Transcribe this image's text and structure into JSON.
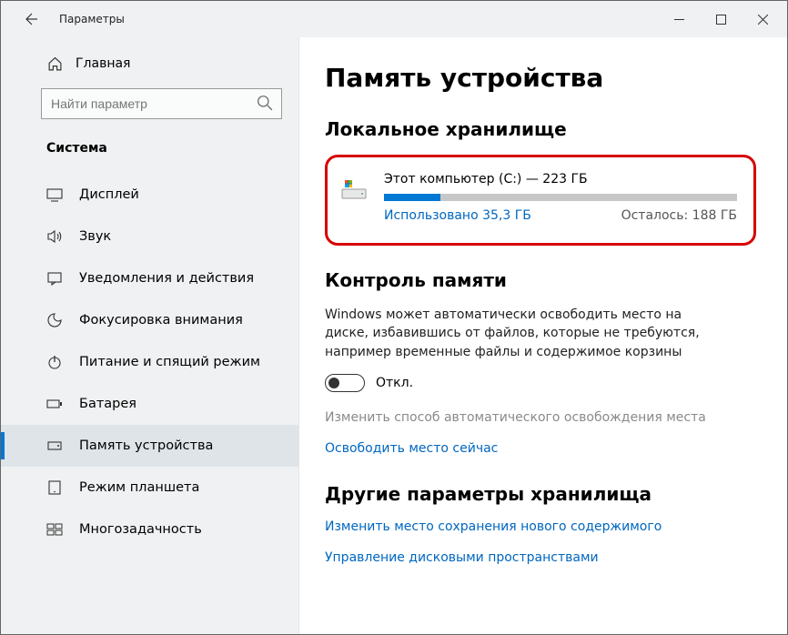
{
  "titlebar": {
    "title": "Параметры"
  },
  "sidebar": {
    "home": "Главная",
    "search_placeholder": "Найти параметр",
    "section": "Система",
    "items": [
      {
        "label": "Дисплей"
      },
      {
        "label": "Звук"
      },
      {
        "label": "Уведомления и действия"
      },
      {
        "label": "Фокусировка внимания"
      },
      {
        "label": "Питание и спящий режим"
      },
      {
        "label": "Батарея"
      },
      {
        "label": "Память устройства"
      },
      {
        "label": "Режим планшета"
      },
      {
        "label": "Многозадачность"
      }
    ]
  },
  "main": {
    "title": "Память устройства",
    "local_storage_title": "Локальное хранилище",
    "drive": {
      "title": "Этот компьютер (C:) — 223 ГБ",
      "used": "Использовано 35,3 ГБ",
      "remaining": "Осталось: 188 ГБ"
    },
    "sense_title": "Контроль памяти",
    "sense_desc": "Windows может автоматически освободить место на диске, избавившись от файлов, которые не требуются, например временные файлы и содержимое корзины",
    "toggle_label": "Откл.",
    "disabled_link": "Изменить способ автоматического освобождения места",
    "free_now": "Освободить место сейчас",
    "other_title": "Другие параметры хранилища",
    "link_change_location": "Изменить место сохранения нового содержимого",
    "link_manage_spaces": "Управление дисковыми пространствами"
  }
}
